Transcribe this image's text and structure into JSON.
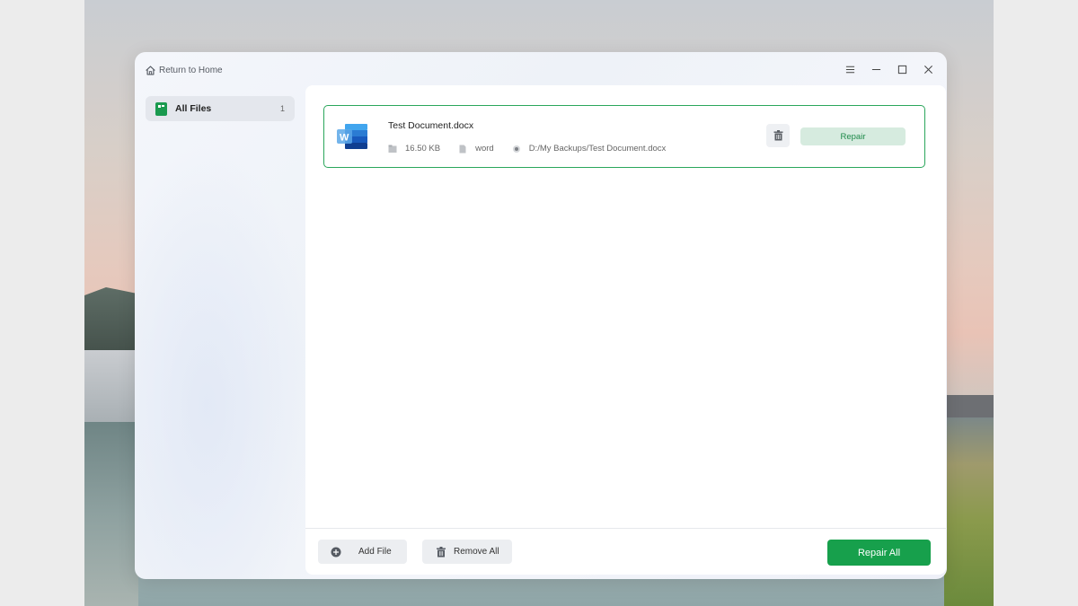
{
  "titlebar": {
    "return_home_label": "Return to Home"
  },
  "sidebar": {
    "items": [
      {
        "label": "All Files",
        "count": "1"
      }
    ]
  },
  "files": [
    {
      "name": "Test Document.docx",
      "size": "16.50 KB",
      "type": "word",
      "path": "D:/My Backups/Test Document.docx",
      "repair_label": "Repair"
    }
  ],
  "footer": {
    "add_file_label": "Add File",
    "remove_all_label": "Remove All",
    "repair_all_label": "Repair All"
  },
  "colors": {
    "accent": "#17a04c",
    "card_border": "#2aa65b",
    "repair_bg": "#d6ebdf"
  }
}
